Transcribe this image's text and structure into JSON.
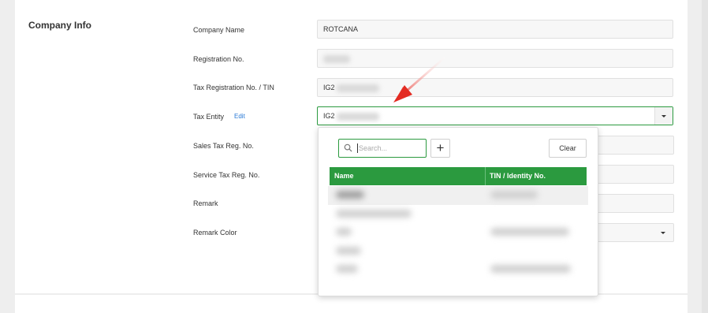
{
  "section": {
    "title": "Company Info"
  },
  "fields": {
    "company_name": {
      "label": "Company Name",
      "value": "ROTCANA"
    },
    "registration_no": {
      "label": "Registration No.",
      "value": ""
    },
    "tax_registration": {
      "label": "Tax Registration No. / TIN",
      "value": "IG2"
    },
    "tax_entity": {
      "label": "Tax Entity",
      "edit_label": "Edit",
      "value": "IG2"
    },
    "sales_tax": {
      "label": "Sales Tax Reg. No."
    },
    "service_tax": {
      "label": "Service Tax Reg. No."
    },
    "remark": {
      "label": "Remark"
    },
    "remark_color": {
      "label": "Remark Color"
    }
  },
  "dropdown": {
    "search_placeholder": "Search...",
    "add_label": "+",
    "clear_label": "Clear",
    "columns": [
      "Name",
      "TIN / Identity No."
    ],
    "rows_blurred": true
  },
  "colors": {
    "accent": "#2b9a3f",
    "link": "#2a7ad6",
    "arrow": "#e8342c"
  }
}
